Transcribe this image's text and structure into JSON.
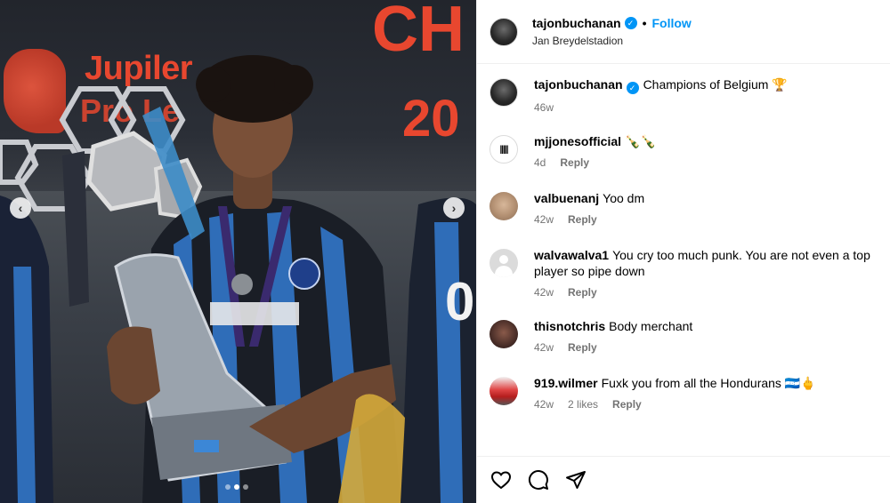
{
  "post": {
    "username": "tajonbuchanan",
    "location": "Jan Breydelstadion",
    "follow_label": "Follow",
    "separator": "•",
    "verified_glyph": "✓",
    "caption": "Champions of Belgium 🏆",
    "caption_time": "46w",
    "image": {
      "banner_word1": "Jupiler",
      "banner_word2": "Pro Le",
      "banner_word3": "CH",
      "banner_word4": "20",
      "carousel_total": 3,
      "carousel_active": 2,
      "prev_glyph": "‹",
      "next_glyph": "›"
    }
  },
  "comments": [
    {
      "user": "mjjonesofficial",
      "text": "🍾🍾",
      "time": "4d",
      "likes": "",
      "reply": "Reply",
      "avatar": "av-mj",
      "avatar_text": "|||||"
    },
    {
      "user": "valbuenanj",
      "text": "Yoo dm",
      "time": "42w",
      "likes": "",
      "reply": "Reply",
      "avatar": "av-val",
      "avatar_text": ""
    },
    {
      "user": "walvawalva1",
      "text": "You cry too much punk. You are not even a top player so pipe down",
      "time": "42w",
      "likes": "",
      "reply": "Reply",
      "avatar": "av-walv",
      "avatar_text": ""
    },
    {
      "user": "thisnotchris",
      "text": "Body merchant",
      "time": "42w",
      "likes": "",
      "reply": "Reply",
      "avatar": "av-this",
      "avatar_text": ""
    },
    {
      "user": "919.wilmer",
      "text": "Fuxk you from all the Hondurans 🇭🇳🖕",
      "time": "42w",
      "likes": "2 likes",
      "reply": "Reply",
      "avatar": "av-919",
      "avatar_text": ""
    }
  ],
  "icons": {
    "like": "heart-icon",
    "comment": "comment-icon",
    "share": "send-icon"
  },
  "colors": {
    "accent": "#0095f6",
    "muted": "#737373",
    "banner_red": "#e8472f"
  }
}
